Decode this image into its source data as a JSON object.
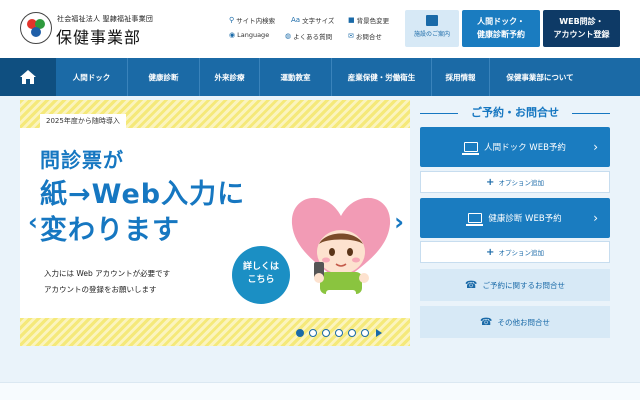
{
  "header": {
    "org_small": "社会福祉法人 聖隷福祉事業団",
    "org_name": "保健事業部",
    "utilities": [
      {
        "icon": "search-icon",
        "label": "サイト内検索"
      },
      {
        "icon": "text-size-icon",
        "label": "文字サイズ"
      },
      {
        "icon": "color-change-icon",
        "label": "背景色変更"
      },
      {
        "icon": "language-icon",
        "label": "Language"
      },
      {
        "icon": "faq-icon",
        "label": "よくある質問"
      },
      {
        "icon": "contact-icon",
        "label": "お問合せ"
      }
    ],
    "facility_button": "施設のご案内",
    "dock_button_line1": "人間ドック・",
    "dock_button_line2": "健康診断予約",
    "web_button_line1": "WEB問診・",
    "web_button_line2": "アカウント登録"
  },
  "nav": {
    "home_icon": "home-icon",
    "items": [
      "人間ドック",
      "健康診断",
      "外来診療",
      "運動教室",
      "産業保健・労働衛生",
      "採用情報",
      "保健事業部について"
    ]
  },
  "banner": {
    "tag": "2025年度から随時導入",
    "headline1": "問診票が",
    "headline2": "紙→Web入力に",
    "headline3": "変わります",
    "note1": "入力には Web アカウントが必要です",
    "note2": "アカウントの登録をお願いします",
    "details_line1": "詳しくは",
    "details_line2": "こちら",
    "slide_count": 6,
    "active_slide": 1
  },
  "panel": {
    "title": "ご予約・お問合せ",
    "dock_reserve": "人間ドック WEB予約",
    "health_reserve": "健康診断 WEB予約",
    "option_add": "オプション追加",
    "reserve_contact": "ご予約に関するお問合せ",
    "other_contact": "その他お問合せ"
  },
  "colors": {
    "primary": "#1a7cc0",
    "nav": "#1b6aa6",
    "dark": "#0e3a66",
    "stripe": "#f5e97a"
  }
}
